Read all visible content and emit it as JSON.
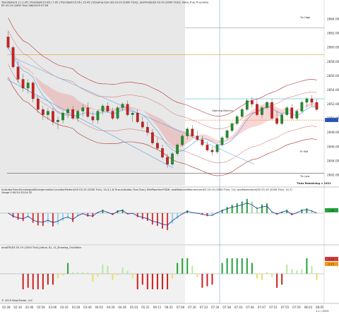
{
  "header": {
    "title_line1": "TrendSeller5.2 | 1.05 | TrendSellr15.65 | 7.05 | TrendSellr15.95 | 15.45 | Drawing tool (ES 03-19 (2000 Tick)), anaPivots(ES 03-19 (2000 Tick)), Valve,True,True,False",
    "title_line2": "ES 03-19 (2000 Tick) 3/8/2019 07:59"
  },
  "panels": {
    "price": {
      "top_label": "Tic High",
      "bottom_label": "Tic Low",
      "mid_label": "Opening Bounce",
      "ask_label": "Pr Mid",
      "ticks_remaining": "Ticks Remaining = 1921",
      "price_tag": "2853.25"
    },
    "macd": {
      "title": "IndicatorTrendCirclesignalDivergenceAscCurveAscPattern(ES 03-19 (2000 Tick), 14,3,1,8,True,Indicator,True,True), BlinPiperlineTSDH, anaBalancedMomentum(ES 03-19 (2000 Tick), 14), anaMomentum(ES 03-19 (2000 Tick), 14,7)",
      "subtitle": "Usage 0.00/14.32/14.32",
      "tag": "1.06"
    },
    "osc": {
      "title": "anaATR(ES 03-19 (2000 Tick)),Value, 8), 12_Drawing_Oscillator",
      "tag_up": "5.10",
      "tag_dn": "3.15"
    }
  },
  "footer": {
    "copyright": "© 2019 NinjaTrader, LLC"
  },
  "watermark": "1.1 / 2019",
  "chart_data": {
    "type": "candlestick",
    "y_axis_labels": [
      "2864.00",
      "2862.00",
      "2860.00",
      "2858.00",
      "2856.00",
      "2854.00",
      "2852.00",
      "2850.00",
      "2848.00",
      "2846.00",
      "2844.00",
      "2842.00"
    ],
    "ylim": [
      2841.0,
      2865.5
    ],
    "levels": {
      "tic_high": 2862.75,
      "tic_low": 2842.25,
      "orange_line": 2859.0,
      "session_bg_color": "#e9e9e9"
    },
    "x_axis_labels": [
      "02:28",
      "02:34",
      "02:46",
      "02:56",
      "03:06",
      "03:16",
      "03:28",
      "03:46",
      "04:02",
      "04:26",
      "04:36",
      "05:03",
      "05:31",
      "06:11",
      "06:32",
      "07:00",
      "07:30",
      "07:33",
      "07:34",
      "07:38",
      "07:43",
      "07:44",
      "07:47",
      "07:51",
      "07:55",
      "07:59",
      "08:03",
      "08:05"
    ],
    "candles": [
      [
        2861.5,
        2862.25,
        2859.75,
        2860.0
      ],
      [
        2860.0,
        2860.25,
        2857.0,
        2857.25
      ],
      [
        2857.25,
        2858.0,
        2855.0,
        2855.5
      ],
      [
        2855.5,
        2856.25,
        2853.75,
        2854.25
      ],
      [
        2854.25,
        2855.5,
        2853.5,
        2855.0
      ],
      [
        2855.0,
        2855.25,
        2852.25,
        2852.75
      ],
      [
        2852.75,
        2853.25,
        2850.75,
        2851.25
      ],
      [
        2851.25,
        2851.75,
        2849.75,
        2850.5
      ],
      [
        2850.5,
        2851.5,
        2849.75,
        2851.0
      ],
      [
        2851.0,
        2851.5,
        2849.0,
        2849.5
      ],
      [
        2849.5,
        2850.25,
        2848.5,
        2849.75
      ],
      [
        2849.75,
        2851.0,
        2849.25,
        2850.75
      ],
      [
        2850.75,
        2851.5,
        2850.0,
        2851.25
      ],
      [
        2851.25,
        2851.75,
        2849.75,
        2850.0
      ],
      [
        2850.0,
        2851.25,
        2849.5,
        2851.0
      ],
      [
        2851.0,
        2852.0,
        2850.25,
        2851.5
      ],
      [
        2851.5,
        2852.25,
        2850.0,
        2850.25
      ],
      [
        2850.25,
        2851.0,
        2849.25,
        2849.75
      ],
      [
        2849.75,
        2851.25,
        2849.25,
        2851.0
      ],
      [
        2851.0,
        2852.0,
        2850.5,
        2851.75
      ],
      [
        2851.75,
        2852.25,
        2850.75,
        2851.0
      ],
      [
        2851.0,
        2851.5,
        2849.75,
        2850.0
      ],
      [
        2850.0,
        2851.75,
        2849.75,
        2851.5
      ],
      [
        2851.5,
        2852.25,
        2851.0,
        2852.0
      ],
      [
        2852.0,
        2852.5,
        2850.25,
        2850.5
      ],
      [
        2850.5,
        2851.0,
        2849.5,
        2850.75
      ],
      [
        2850.75,
        2851.25,
        2849.25,
        2849.5
      ],
      [
        2849.5,
        2850.25,
        2848.5,
        2848.75
      ],
      [
        2848.75,
        2849.5,
        2847.5,
        2848.0
      ],
      [
        2848.0,
        2848.5,
        2846.25,
        2846.5
      ],
      [
        2846.5,
        2847.25,
        2845.5,
        2845.75
      ],
      [
        2845.75,
        2846.25,
        2844.25,
        2844.5
      ],
      [
        2844.5,
        2845.0,
        2843.0,
        2843.5
      ],
      [
        2843.5,
        2845.25,
        2843.25,
        2845.0
      ],
      [
        2845.0,
        2846.5,
        2844.75,
        2846.25
      ],
      [
        2846.25,
        2847.75,
        2846.0,
        2847.5
      ],
      [
        2847.5,
        2848.75,
        2847.0,
        2848.5
      ],
      [
        2848.5,
        2849.0,
        2847.25,
        2847.5
      ],
      [
        2847.5,
        2848.25,
        2846.75,
        2847.0
      ],
      [
        2847.0,
        2847.5,
        2846.0,
        2846.25
      ],
      [
        2846.25,
        2846.75,
        2845.25,
        2845.5
      ],
      [
        2845.5,
        2846.0,
        2844.75,
        2845.25
      ],
      [
        2845.25,
        2846.5,
        2845.0,
        2846.25
      ],
      [
        2846.25,
        2847.5,
        2846.0,
        2847.25
      ],
      [
        2847.25,
        2848.5,
        2847.0,
        2848.25
      ],
      [
        2848.25,
        2849.5,
        2848.0,
        2849.25
      ],
      [
        2849.25,
        2850.5,
        2849.0,
        2850.25
      ],
      [
        2850.25,
        2851.5,
        2850.0,
        2851.25
      ],
      [
        2851.25,
        2852.75,
        2851.0,
        2852.5
      ],
      [
        2852.5,
        2853.0,
        2851.5,
        2852.0
      ],
      [
        2852.0,
        2852.75,
        2850.25,
        2850.5
      ],
      [
        2850.5,
        2851.75,
        2850.0,
        2851.5
      ],
      [
        2851.5,
        2852.5,
        2851.25,
        2852.25
      ],
      [
        2852.25,
        2852.75,
        2849.75,
        2850.0
      ],
      [
        2850.0,
        2851.0,
        2849.0,
        2849.25
      ],
      [
        2849.25,
        2850.75,
        2849.0,
        2850.5
      ],
      [
        2850.5,
        2851.75,
        2850.25,
        2851.5
      ],
      [
        2851.5,
        2852.0,
        2849.75,
        2850.0
      ],
      [
        2850.0,
        2851.25,
        2849.75,
        2851.0
      ],
      [
        2851.0,
        2852.5,
        2850.75,
        2852.25
      ],
      [
        2852.25,
        2853.0,
        2851.5,
        2852.75
      ],
      [
        2852.75,
        2853.25,
        2851.75,
        2852.25
      ],
      [
        2852.25,
        2852.75,
        2851.0,
        2851.25
      ]
    ]
  }
}
